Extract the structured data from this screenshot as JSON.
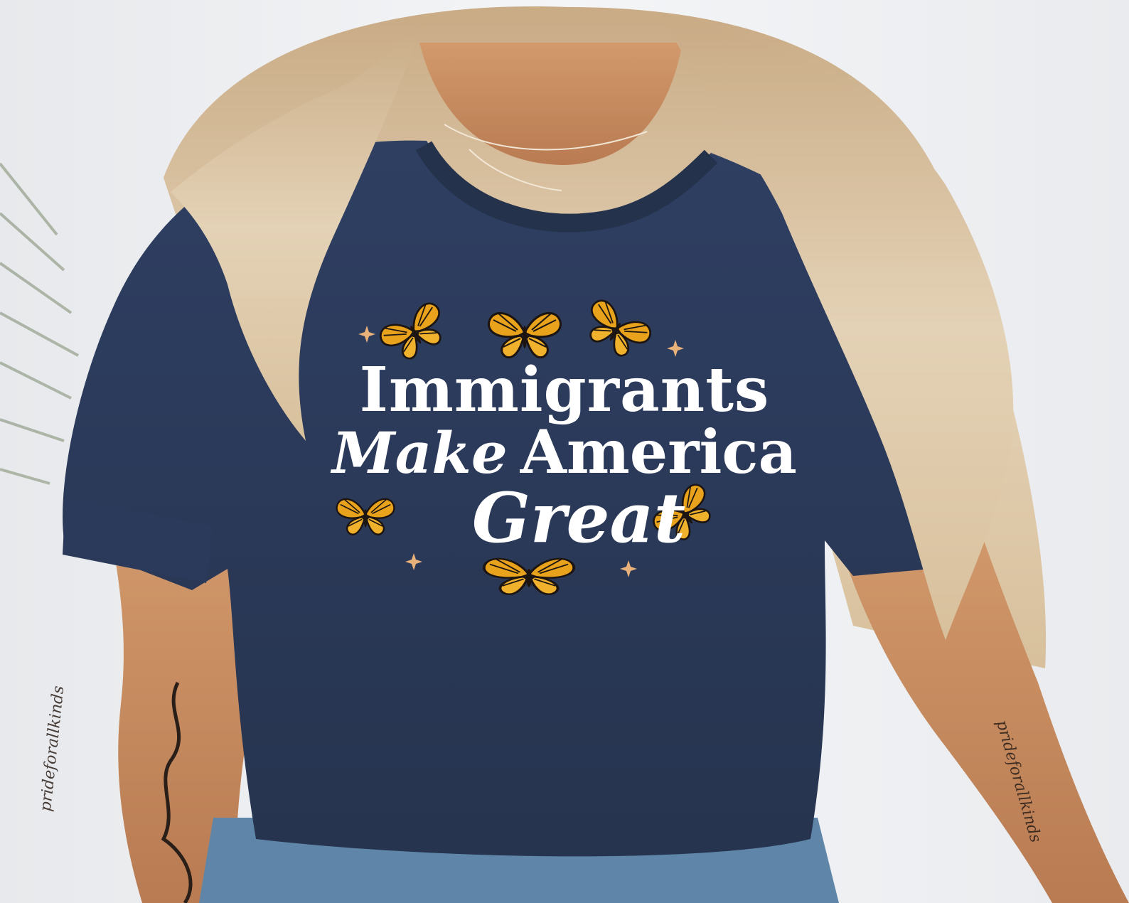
{
  "shirt_print": {
    "line1": "Immigrants",
    "line2_script": "Make",
    "line2_bold": "America",
    "line3": "Great"
  },
  "watermarks": {
    "left_arm": "pridefor​allkinds",
    "right_arm": "pridefor​allkinds"
  },
  "colors": {
    "shirt": "#2b3a5c",
    "print_text": "#ffffff",
    "butterfly_orange": "#e8a21c",
    "sparkle": "#e9b27a",
    "hair": "#d9c2a0",
    "skin": "#c98f62",
    "jeans": "#5f86a8",
    "background": "#eef0f2"
  },
  "icons": [
    "monarch-butterfly-icon",
    "sparkle-icon"
  ]
}
